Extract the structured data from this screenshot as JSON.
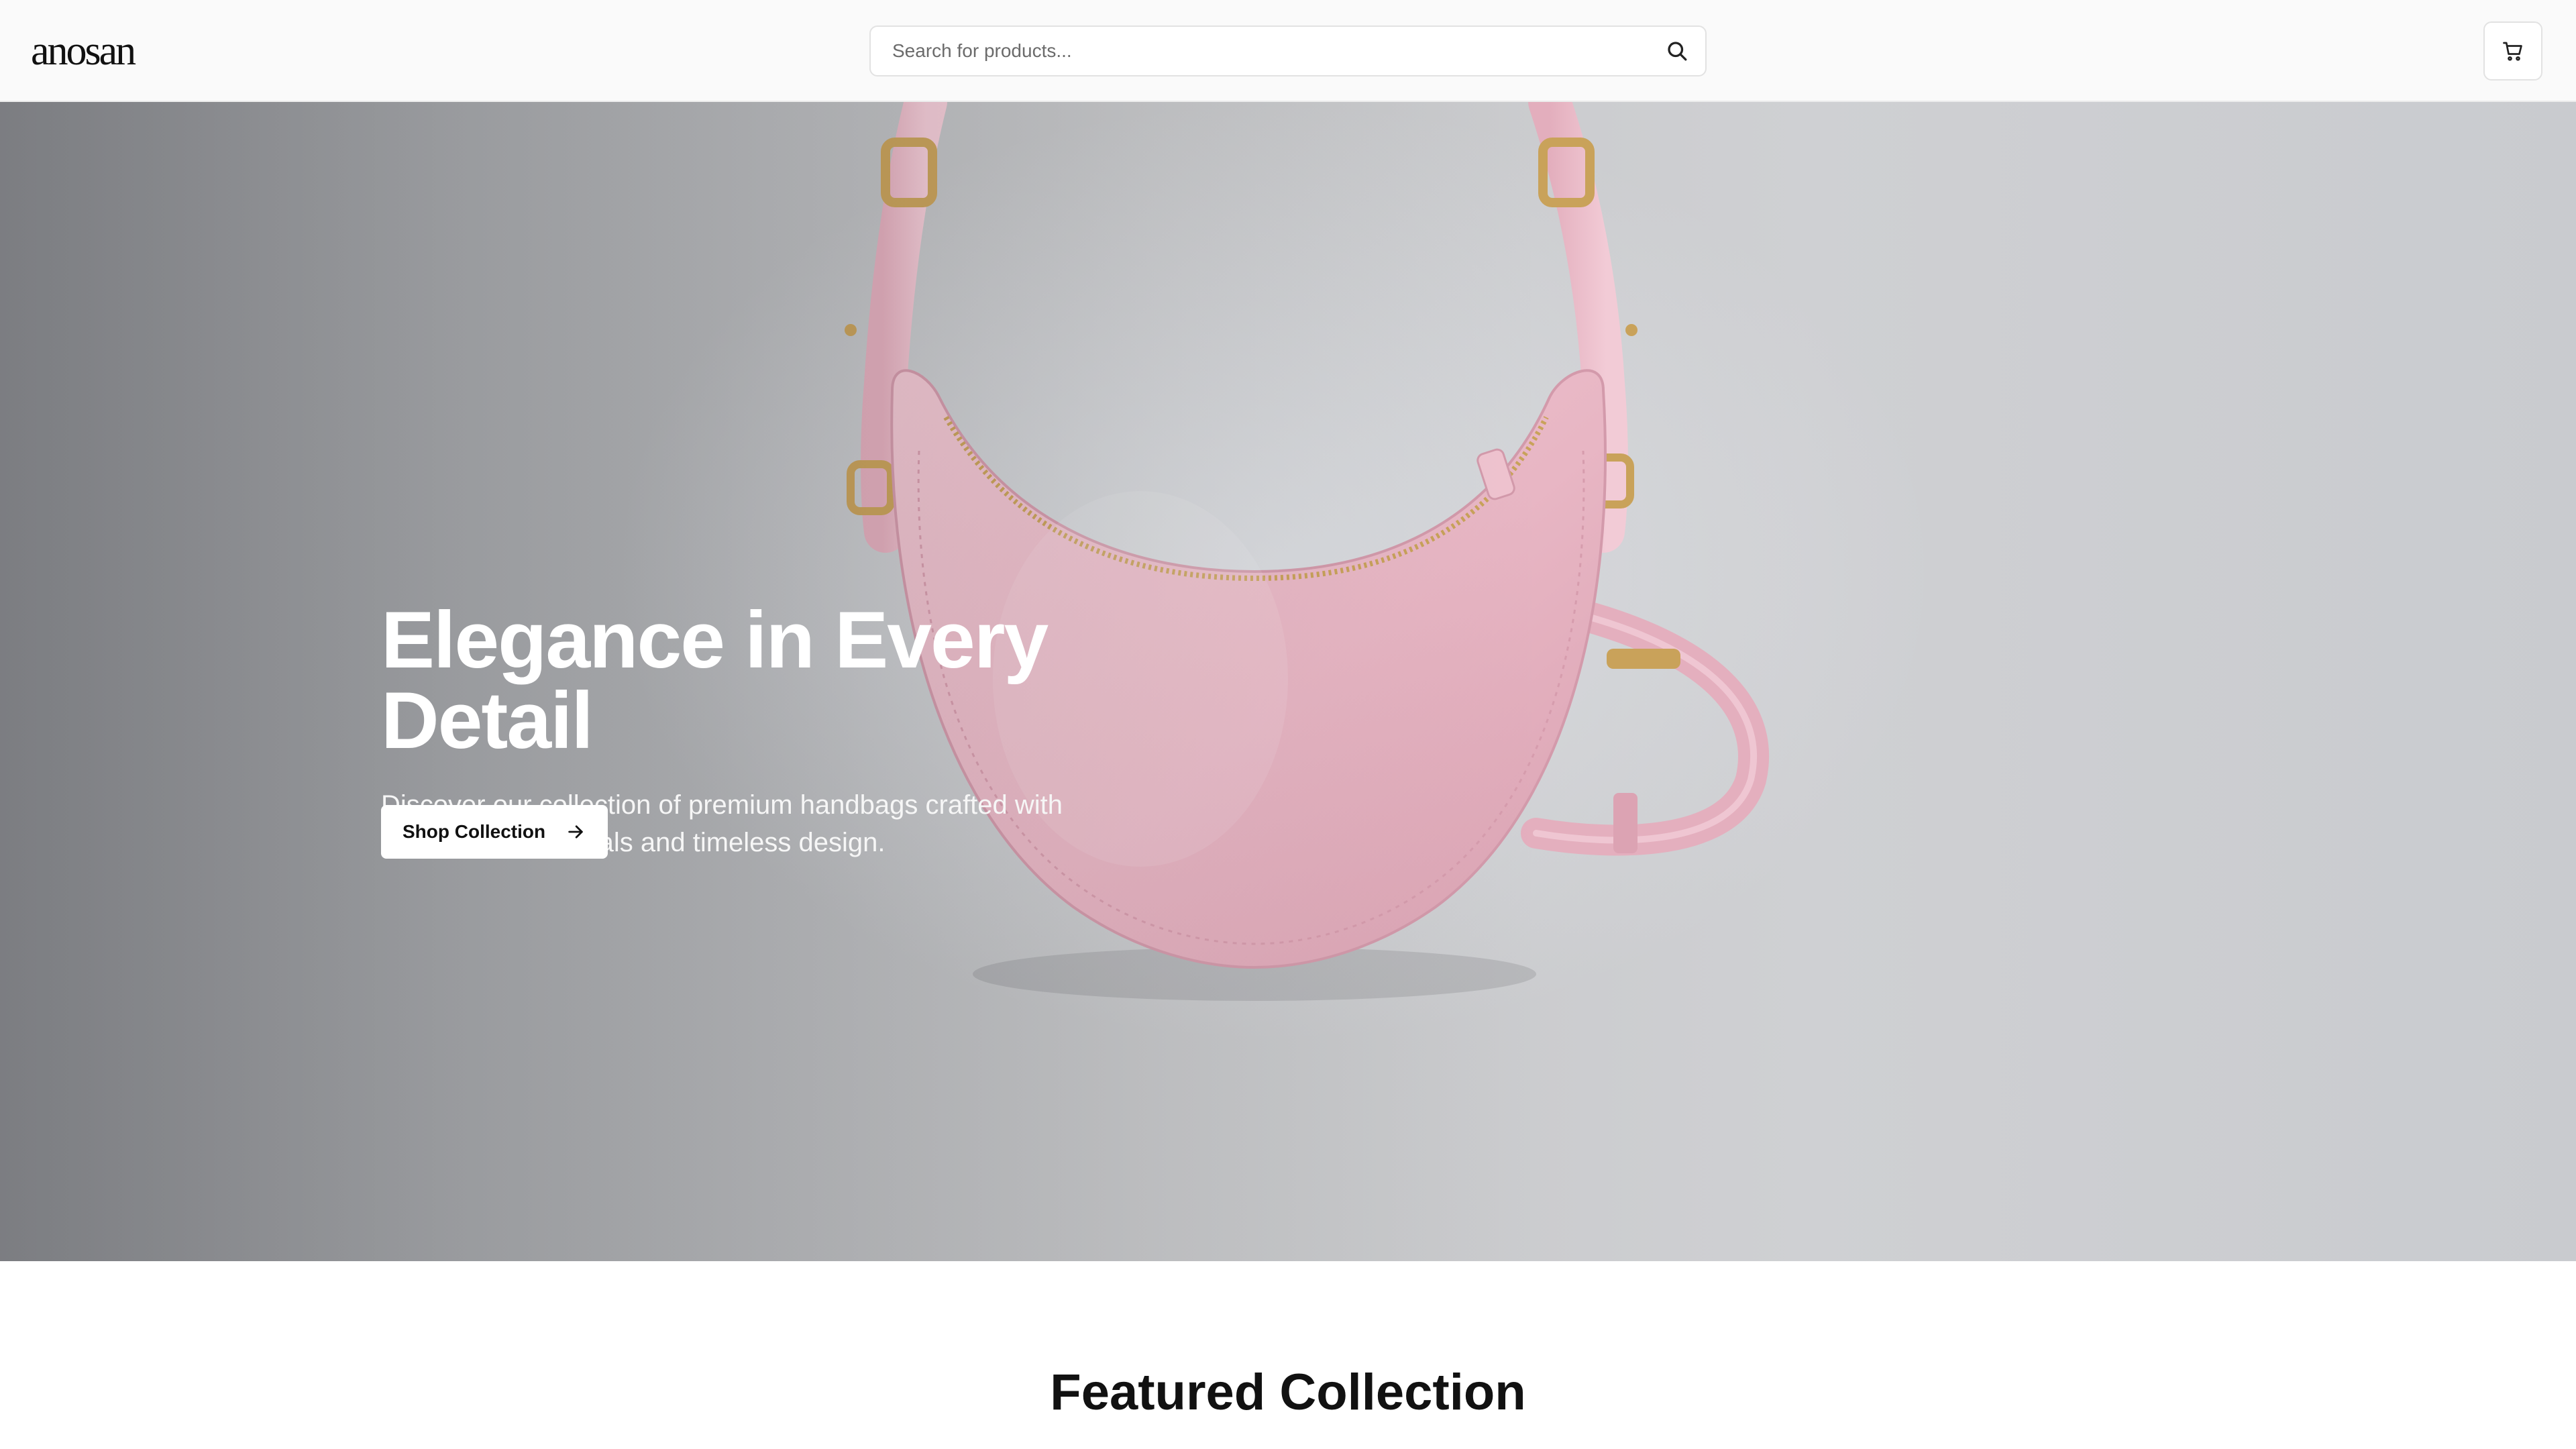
{
  "header": {
    "logo_text": "anosan",
    "search": {
      "placeholder": "Search for products...",
      "value": ""
    },
    "cart_icon": "cart-icon",
    "search_icon": "search-icon"
  },
  "hero": {
    "title": "Elegance in Every Detail",
    "subtitle": "Discover our collection of premium handbags crafted with exceptional materials and timeless design.",
    "cta_label": "Shop Collection",
    "cta_icon": "arrow-right-icon",
    "image": "pink-crescent-handbag"
  },
  "featured": {
    "title": "Featured Collection"
  },
  "colors": {
    "header_bg": "#fafafa",
    "hero_text": "#ffffff",
    "bag_pink": "#e9b8c6",
    "hardware_gold": "#c9a25a"
  }
}
